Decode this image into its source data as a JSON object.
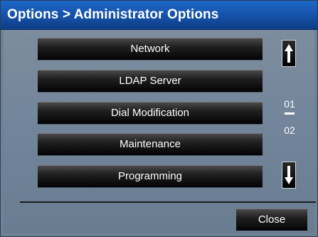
{
  "window": {
    "title": "Options > Administrator Options"
  },
  "menu": {
    "items": [
      {
        "label": "Network"
      },
      {
        "label": "LDAP Server"
      },
      {
        "label": "Dial Modification"
      },
      {
        "label": "Maintenance"
      },
      {
        "label": "Programming"
      }
    ]
  },
  "pager": {
    "current": "01",
    "total": "02",
    "up_icon": "arrow-up-icon",
    "down_icon": "arrow-down-icon"
  },
  "footer": {
    "close_label": "Close"
  },
  "colors": {
    "title_bar": "#1755ad",
    "panel": "#72849a",
    "button": "#101010",
    "text": "#ffffff"
  }
}
